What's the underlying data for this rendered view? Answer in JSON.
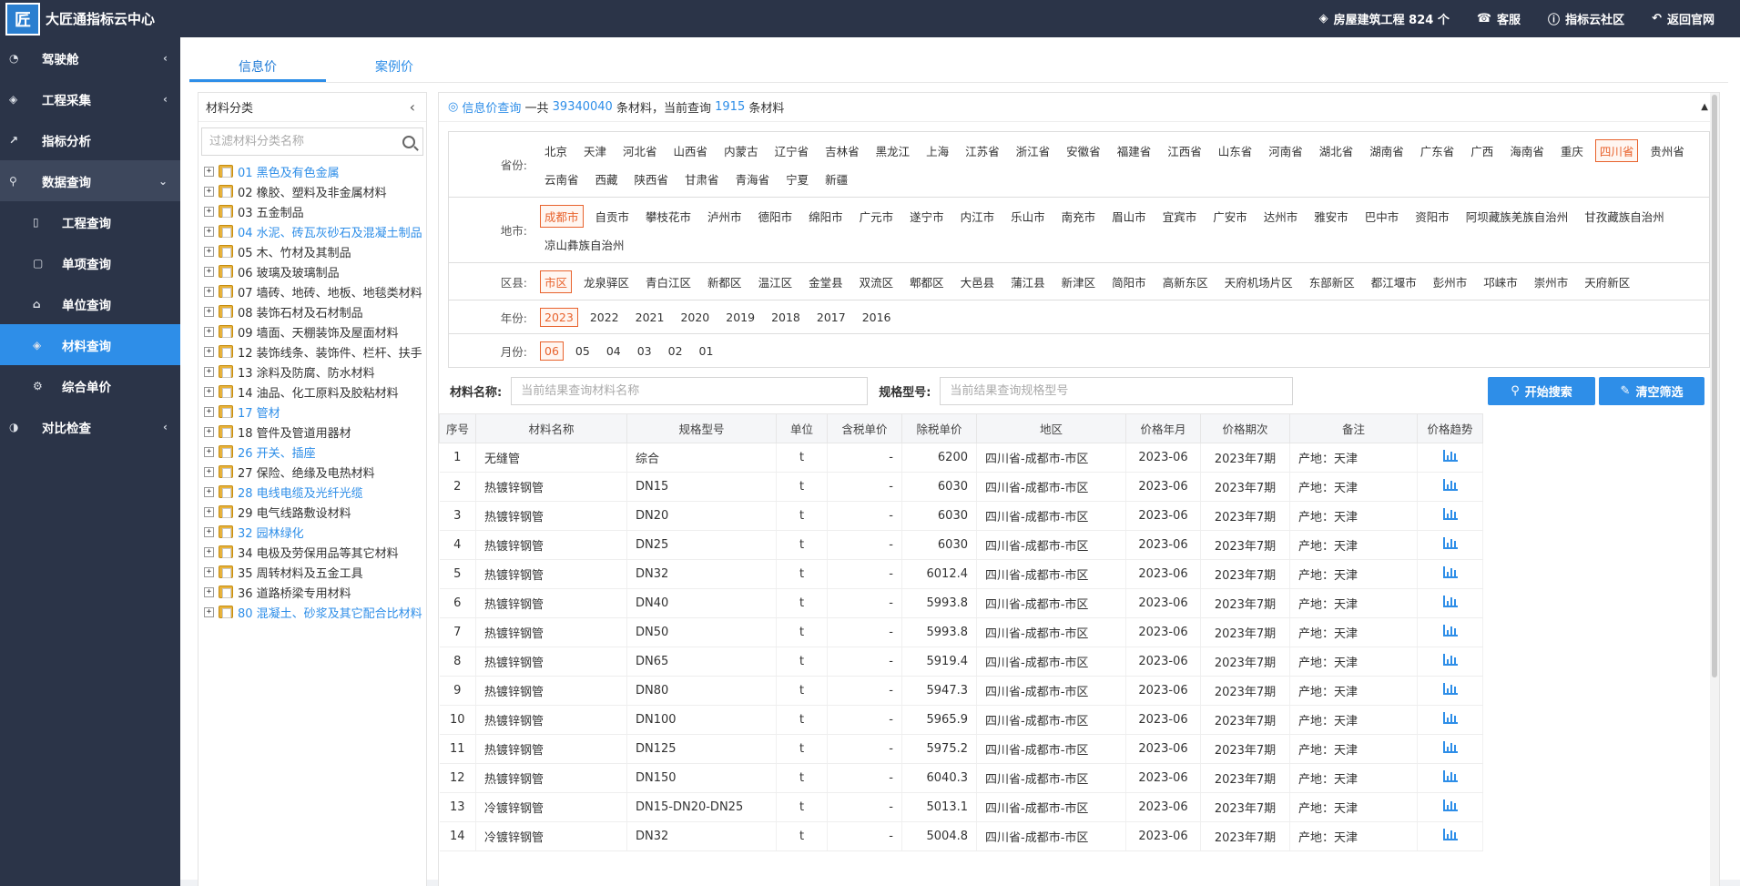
{
  "app": {
    "title": "大匠通指标云中心",
    "logo_text": "匠"
  },
  "topbar": {
    "items": [
      {
        "label": "房屋建筑工程 824 个",
        "icon": "cube-icon"
      },
      {
        "label": "客服",
        "icon": "phone-icon"
      },
      {
        "label": "指标云社区",
        "icon": "info-icon"
      },
      {
        "label": "返回官网",
        "icon": "return-icon"
      }
    ]
  },
  "sidebar": {
    "items": [
      {
        "label": "驾驶舱"
      },
      {
        "label": "工程采集"
      },
      {
        "label": "指标分析"
      },
      {
        "label": "数据查询"
      },
      {
        "label": "工程查询"
      },
      {
        "label": "单项查询"
      },
      {
        "label": "单位查询"
      },
      {
        "label": "材料查询"
      },
      {
        "label": "综合单价"
      },
      {
        "label": "对比检查"
      }
    ]
  },
  "tabs": [
    {
      "label": "信息价"
    },
    {
      "label": "案例价"
    }
  ],
  "tree": {
    "title": "材料分类",
    "search_placeholder": "过滤材料分类名称",
    "items": [
      {
        "label": "01 黑色及有色金属",
        "hl": true
      },
      {
        "label": "02 橡胶、塑料及非金属材料",
        "hl": false
      },
      {
        "label": "03 五金制品",
        "hl": false
      },
      {
        "label": "04 水泥、砖瓦灰砂石及混凝土制品",
        "hl": true
      },
      {
        "label": "05 木、竹材及其制品",
        "hl": false
      },
      {
        "label": "06 玻璃及玻璃制品",
        "hl": false
      },
      {
        "label": "07 墙砖、地砖、地板、地毯类材料",
        "hl": false
      },
      {
        "label": "08 装饰石材及石材制品",
        "hl": false
      },
      {
        "label": "09 墙面、天棚装饰及屋面材料",
        "hl": false
      },
      {
        "label": "12 装饰线条、装饰件、栏杆、扶手",
        "hl": false
      },
      {
        "label": "13 涂料及防腐、防水材料",
        "hl": false
      },
      {
        "label": "14 油品、化工原料及胶粘材料",
        "hl": false
      },
      {
        "label": "17 管材",
        "hl": true
      },
      {
        "label": "18 管件及管道用器材",
        "hl": false
      },
      {
        "label": "26 开关、插座",
        "hl": true
      },
      {
        "label": "27 保险、绝缘及电热材料",
        "hl": false
      },
      {
        "label": "28 电线电缆及光纤光缆",
        "hl": true
      },
      {
        "label": "29 电气线路敷设材料",
        "hl": false
      },
      {
        "label": "32 园林绿化",
        "hl": true
      },
      {
        "label": "34 电极及劳保用品等其它材料",
        "hl": false
      },
      {
        "label": "35 周转材料及五金工具",
        "hl": false
      },
      {
        "label": "36 道路桥梁专用材料",
        "hl": false
      },
      {
        "label": "80 混凝土、砂浆及其它配合比材料",
        "hl": true
      }
    ]
  },
  "summary": {
    "link": "信息价查询",
    "text1": "一共",
    "total": "39340040",
    "text2": "条材料，当前查询",
    "current": "1915",
    "text3": "条材料"
  },
  "filters": [
    {
      "label": "省份:",
      "selected": "四川省",
      "options": [
        "北京",
        "天津",
        "河北省",
        "山西省",
        "内蒙古",
        "辽宁省",
        "吉林省",
        "黑龙江",
        "上海",
        "江苏省",
        "浙江省",
        "安徽省",
        "福建省",
        "江西省",
        "山东省",
        "河南省",
        "湖北省",
        "湖南省",
        "广东省",
        "广西",
        "海南省",
        "重庆",
        "四川省",
        "贵州省",
        "云南省",
        "西藏",
        "陕西省",
        "甘肃省",
        "青海省",
        "宁夏",
        "新疆"
      ]
    },
    {
      "label": "地市:",
      "selected": "成都市",
      "options": [
        "成都市",
        "自贡市",
        "攀枝花市",
        "泸州市",
        "德阳市",
        "绵阳市",
        "广元市",
        "遂宁市",
        "内江市",
        "乐山市",
        "南充市",
        "眉山市",
        "宜宾市",
        "广安市",
        "达州市",
        "雅安市",
        "巴中市",
        "资阳市",
        "阿坝藏族羌族自治州",
        "甘孜藏族自治州",
        "凉山彝族自治州"
      ]
    },
    {
      "label": "区县:",
      "selected": "市区",
      "options": [
        "市区",
        "龙泉驿区",
        "青白江区",
        "新都区",
        "温江区",
        "金堂县",
        "双流区",
        "郫都区",
        "大邑县",
        "蒲江县",
        "新津区",
        "简阳市",
        "高新东区",
        "天府机场片区",
        "东部新区",
        "都江堰市",
        "彭州市",
        "邛崃市",
        "崇州市",
        "天府新区"
      ]
    },
    {
      "label": "年份:",
      "selected": "2023",
      "options": [
        "2023",
        "2022",
        "2021",
        "2020",
        "2019",
        "2018",
        "2017",
        "2016"
      ]
    },
    {
      "label": "月份:",
      "selected": "06",
      "options": [
        "06",
        "05",
        "04",
        "03",
        "02",
        "01"
      ]
    }
  ],
  "search": {
    "name_label": "材料名称:",
    "name_placeholder": "当前结果查询材料名称",
    "spec_label": "规格型号:",
    "spec_placeholder": "当前结果查询规格型号",
    "start_button": "开始搜索",
    "clear_button": "清空筛选"
  },
  "table": {
    "headers": [
      "序号",
      "材料名称",
      "规格型号",
      "单位",
      "含税单价",
      "除税单价",
      "地区",
      "价格年月",
      "价格期次",
      "备注",
      "价格趋势"
    ],
    "rows": [
      [
        "1",
        "无缝管",
        "综合",
        "t",
        "-",
        "6200",
        "四川省-成都市-市区",
        "2023-06",
        "2023年7期",
        "产地：天津"
      ],
      [
        "2",
        "热镀锌钢管",
        "DN15",
        "t",
        "-",
        "6030",
        "四川省-成都市-市区",
        "2023-06",
        "2023年7期",
        "产地：天津"
      ],
      [
        "3",
        "热镀锌钢管",
        "DN20",
        "t",
        "-",
        "6030",
        "四川省-成都市-市区",
        "2023-06",
        "2023年7期",
        "产地：天津"
      ],
      [
        "4",
        "热镀锌钢管",
        "DN25",
        "t",
        "-",
        "6030",
        "四川省-成都市-市区",
        "2023-06",
        "2023年7期",
        "产地：天津"
      ],
      [
        "5",
        "热镀锌钢管",
        "DN32",
        "t",
        "-",
        "6012.4",
        "四川省-成都市-市区",
        "2023-06",
        "2023年7期",
        "产地：天津"
      ],
      [
        "6",
        "热镀锌钢管",
        "DN40",
        "t",
        "-",
        "5993.8",
        "四川省-成都市-市区",
        "2023-06",
        "2023年7期",
        "产地：天津"
      ],
      [
        "7",
        "热镀锌钢管",
        "DN50",
        "t",
        "-",
        "5993.8",
        "四川省-成都市-市区",
        "2023-06",
        "2023年7期",
        "产地：天津"
      ],
      [
        "8",
        "热镀锌钢管",
        "DN65",
        "t",
        "-",
        "5919.4",
        "四川省-成都市-市区",
        "2023-06",
        "2023年7期",
        "产地：天津"
      ],
      [
        "9",
        "热镀锌钢管",
        "DN80",
        "t",
        "-",
        "5947.3",
        "四川省-成都市-市区",
        "2023-06",
        "2023年7期",
        "产地：天津"
      ],
      [
        "10",
        "热镀锌钢管",
        "DN100",
        "t",
        "-",
        "5965.9",
        "四川省-成都市-市区",
        "2023-06",
        "2023年7期",
        "产地：天津"
      ],
      [
        "11",
        "热镀锌钢管",
        "DN125",
        "t",
        "-",
        "5975.2",
        "四川省-成都市-市区",
        "2023-06",
        "2023年7期",
        "产地：天津"
      ],
      [
        "12",
        "热镀锌钢管",
        "DN150",
        "t",
        "-",
        "6040.3",
        "四川省-成都市-市区",
        "2023-06",
        "2023年7期",
        "产地：天津"
      ],
      [
        "13",
        "冷镀锌钢管",
        "DN15-DN20-DN25",
        "t",
        "-",
        "5013.1",
        "四川省-成都市-市区",
        "2023-06",
        "2023年7期",
        "产地：天津"
      ],
      [
        "14",
        "冷镀锌钢管",
        "DN32",
        "t",
        "-",
        "5004.8",
        "四川省-成都市-市区",
        "2023-06",
        "2023年7期",
        "产地：天津"
      ]
    ]
  },
  "colors": {
    "primary": "#2e8ee8",
    "dark": "#2b3448",
    "selected": "#e8622c"
  }
}
